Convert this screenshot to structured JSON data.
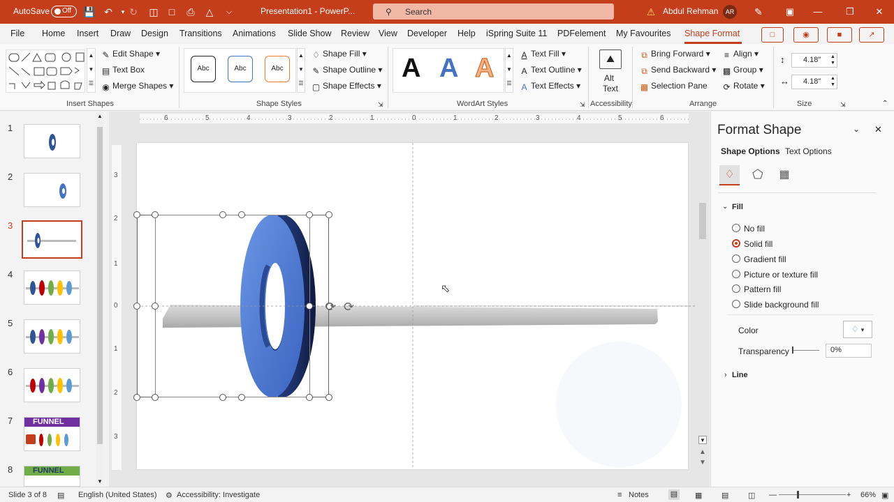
{
  "titlebar": {
    "autosave_label": "AutoSave",
    "autosave_state": "Off",
    "doc_title": "Presentation1  -  PowerP...",
    "search_placeholder": "Search",
    "user_name": "Abdul Rehman",
    "user_initials": "AR",
    "accent_color": "#c43e1c"
  },
  "tabs": [
    "File",
    "Home",
    "Insert",
    "Draw",
    "Design",
    "Transitions",
    "Animations",
    "Slide Show",
    "Review",
    "View",
    "Developer",
    "Help",
    "iSpring Suite 11",
    "PDFelement",
    "My Favourites",
    "Shape Format"
  ],
  "active_tab": "Shape Format",
  "ribbon": {
    "insert_shapes": {
      "edit_shape": "Edit Shape",
      "text_box": "Text Box",
      "merge_shapes": "Merge Shapes",
      "group_label": "Insert Shapes"
    },
    "shape_styles": {
      "preset": "Abc",
      "shape_fill": "Shape Fill",
      "shape_outline": "Shape Outline",
      "shape_effects": "Shape Effects",
      "group_label": "Shape Styles"
    },
    "wordart": {
      "letter": "A",
      "text_fill": "Text Fill",
      "text_outline": "Text Outline",
      "text_effects": "Text Effects",
      "group_label": "WordArt Styles"
    },
    "accessibility": {
      "alt_text_1": "Alt",
      "alt_text_2": "Text",
      "group_label": "Accessibility"
    },
    "arrange": {
      "bring_forward": "Bring Forward",
      "send_backward": "Send Backward",
      "selection_pane": "Selection Pane",
      "align": "Align",
      "group": "Group",
      "rotate": "Rotate",
      "group_label": "Arrange"
    },
    "size": {
      "height": "4.18\"",
      "width": "4.18\"",
      "group_label": "Size"
    }
  },
  "slides": [
    {
      "num": "1"
    },
    {
      "num": "2"
    },
    {
      "num": "3"
    },
    {
      "num": "4"
    },
    {
      "num": "5"
    },
    {
      "num": "6"
    },
    {
      "num": "7",
      "title": "FUNNEL"
    },
    {
      "num": "8",
      "title": "FUNNEL"
    }
  ],
  "selected_slide": "3",
  "ruler": {
    "horizontal": [
      "6",
      "5",
      "4",
      "3",
      "2",
      "1",
      "0",
      "1",
      "2",
      "3",
      "4",
      "5",
      "6"
    ],
    "vertical": [
      "3",
      "2",
      "1",
      "0",
      "1",
      "2",
      "3"
    ]
  },
  "format_panel": {
    "title": "Format Shape",
    "tab_shape_options": "Shape Options",
    "tab_text_options": "Text Options",
    "fill_header": "Fill",
    "fill_options": [
      "No fill",
      "Solid fill",
      "Gradient fill",
      "Picture or texture fill",
      "Pattern fill",
      "Slide background fill"
    ],
    "selected_fill": "Solid fill",
    "color_label": "Color",
    "transparency_label": "Transparency",
    "transparency_value": "0%",
    "line_header": "Line"
  },
  "status": {
    "slide_info": "Slide 3 of 8",
    "language": "English (United States)",
    "accessibility": "Accessibility: Investigate",
    "notes": "Notes",
    "zoom": "66%"
  }
}
